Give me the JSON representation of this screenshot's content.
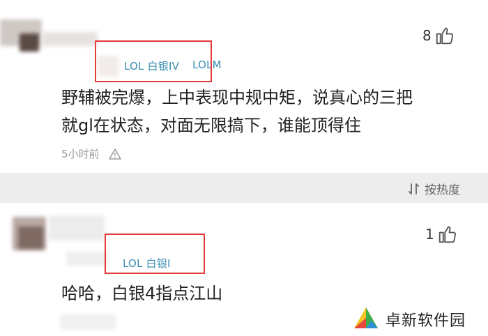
{
  "comments": [
    {
      "likes": "8",
      "badges": [
        "LOL 白银IV",
        "LOLM"
      ],
      "text_line1": "野辅被完爆，上中表现中规中矩，说真心的三把",
      "text_line2": "就gl在状态，对面无限搞下，谁能顶得住",
      "time": "5小时前"
    },
    {
      "likes": "1",
      "badges": [
        "LOL 白银I"
      ],
      "text_line1": "哈哈，白银4指点江山"
    }
  ],
  "sort_label": "按热度",
  "watermark": "卓新软件园",
  "colors": {
    "badge": "#3a8db0",
    "highlight_box": "#e33a3a",
    "divider_bg": "#ededed"
  }
}
